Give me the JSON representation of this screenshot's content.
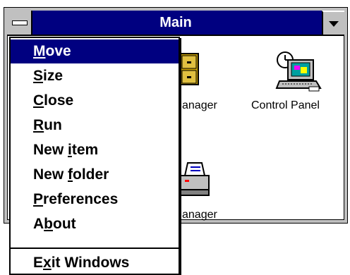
{
  "window": {
    "title": "Main",
    "icons": [
      {
        "label": "anager",
        "icon": "file-cabinet-icon"
      },
      {
        "label": "Control Panel",
        "icon": "control-panel-icon"
      },
      {
        "label": "anager",
        "icon": "printer-icon"
      }
    ]
  },
  "control_menu": {
    "items": [
      {
        "label": "Move",
        "mnemonic": "M",
        "selected": true
      },
      {
        "label": "Size",
        "mnemonic": "S"
      },
      {
        "label": "Close",
        "mnemonic": "C"
      },
      {
        "label": "Run",
        "mnemonic": "R"
      },
      {
        "label": "New item",
        "mnemonic": "i"
      },
      {
        "label": "New folder",
        "mnemonic": "f"
      },
      {
        "label": "Preferences",
        "mnemonic": "P"
      },
      {
        "label": "About",
        "mnemonic": "b"
      },
      {
        "label": "Exit Windows",
        "mnemonic": "x"
      }
    ]
  },
  "colors": {
    "titlebar": "#000080",
    "highlight": "#000080",
    "frame": "#c0c0c0"
  }
}
